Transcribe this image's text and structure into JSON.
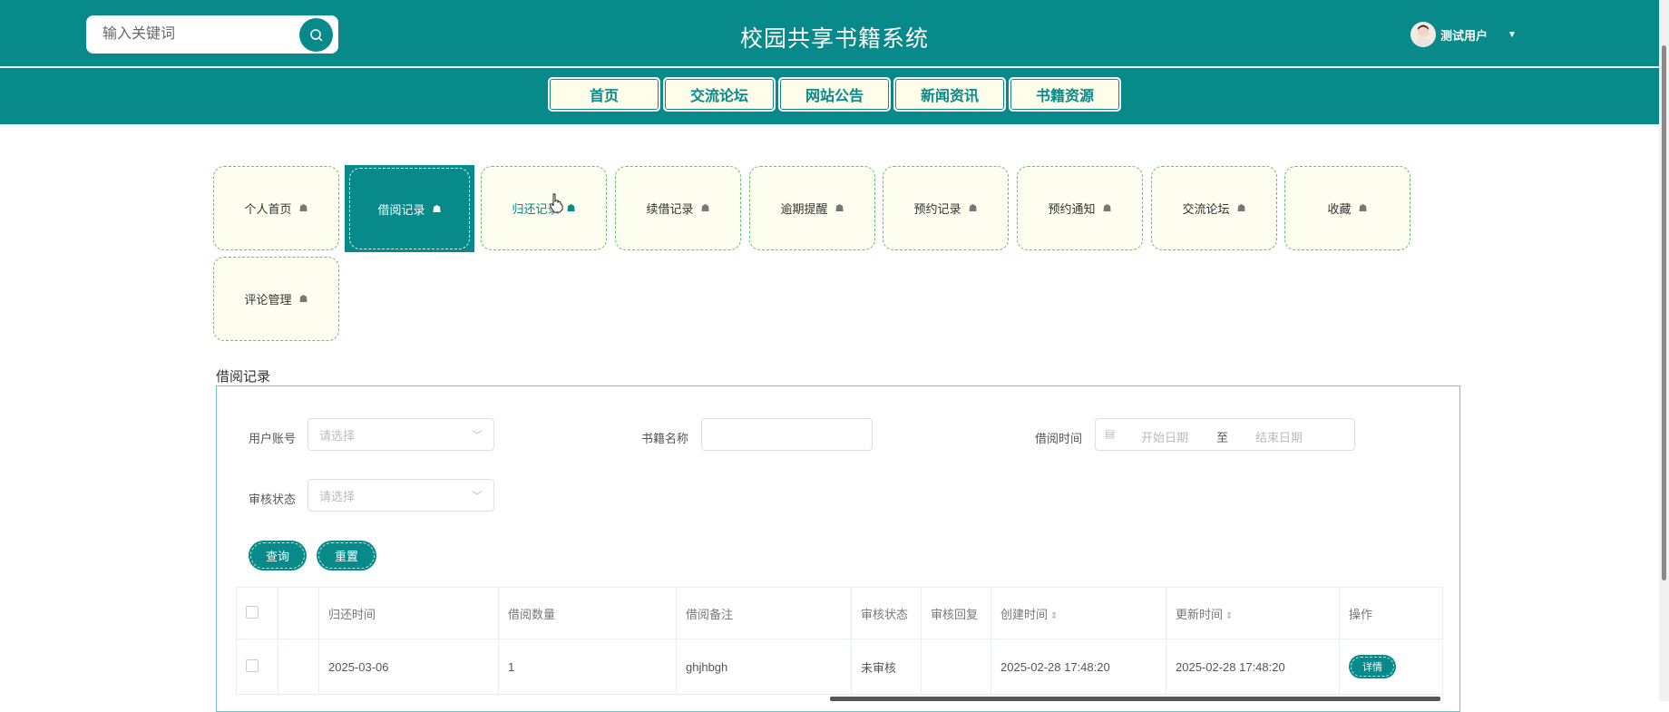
{
  "header": {
    "search_placeholder": "输入关键词",
    "site_title": "校园共享书籍系统",
    "user_name": "测试用户"
  },
  "nav": [
    "首页",
    "交流论坛",
    "网站公告",
    "新闻资讯",
    "书籍资源"
  ],
  "tabs": [
    "个人首页",
    "借阅记录",
    "归还记录",
    "续借记录",
    "逾期提醒",
    "预约记录",
    "预约通知",
    "交流论坛",
    "收藏",
    "评论管理"
  ],
  "active_tab": "借阅记录",
  "section_title": "借阅记录",
  "filters": {
    "user_account_label": "用户账号",
    "user_account_placeholder": "请选择",
    "book_name_label": "书籍名称",
    "borrow_time_label": "借阅时间",
    "start_date": "开始日期",
    "range_sep": "至",
    "end_date": "结束日期",
    "audit_status_label": "审核状态",
    "audit_status_placeholder": "请选择",
    "query_button": "查询",
    "reset_button": "重置"
  },
  "table": {
    "headers": [
      "归还时间",
      "借阅数量",
      "借阅备注",
      "审核状态",
      "审核回复",
      "创建时间",
      "更新时间",
      "操作"
    ],
    "rows": [
      {
        "return_time": "2025-03-06",
        "quantity": "1",
        "remark": "ghjhbgh",
        "audit_status": "未审核",
        "audit_reply": "",
        "created": "2025-02-28 17:48:20",
        "updated": "2025-02-28 17:48:20",
        "action": "详情"
      }
    ]
  }
}
